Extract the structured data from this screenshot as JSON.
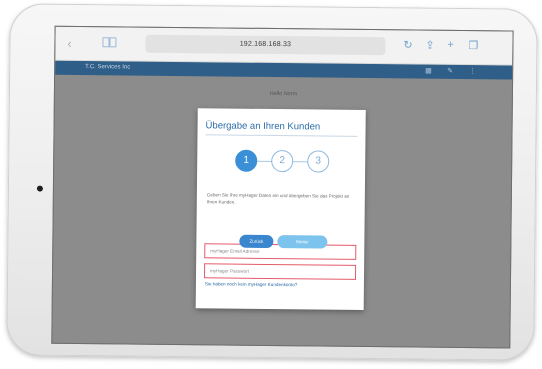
{
  "browser": {
    "back_icon": "back-chevron-icon",
    "url": "192.168.168.33",
    "icons": [
      "reload-icon",
      "share-icon",
      "new-tab-icon",
      "tabs-icon"
    ]
  },
  "app": {
    "brand": "T.C. Services Inc",
    "page_label": "Hello Norm",
    "header_icons": [
      "grid-icon",
      "pen-icon",
      "menu-icon"
    ]
  },
  "modal": {
    "title": "Übergabe an Ihren Kunden",
    "steps": [
      "1",
      "2",
      "3"
    ],
    "active_step": 1,
    "instructions": "Geben Sie Ihre myHager Daten ein und übergeben Sie das Projekt an Ihren Kunden.",
    "email_placeholder": "myHager Email Adresse",
    "password_placeholder": "myHager Passwort",
    "link_text": "Sie haben noch kein myHager Kundenkonto?",
    "back_button": "Zurück",
    "next_button": "Weiter"
  },
  "colors": {
    "accent": "#3a8fd6",
    "header": "#2f5e88",
    "error_border": "#e35b6a"
  }
}
